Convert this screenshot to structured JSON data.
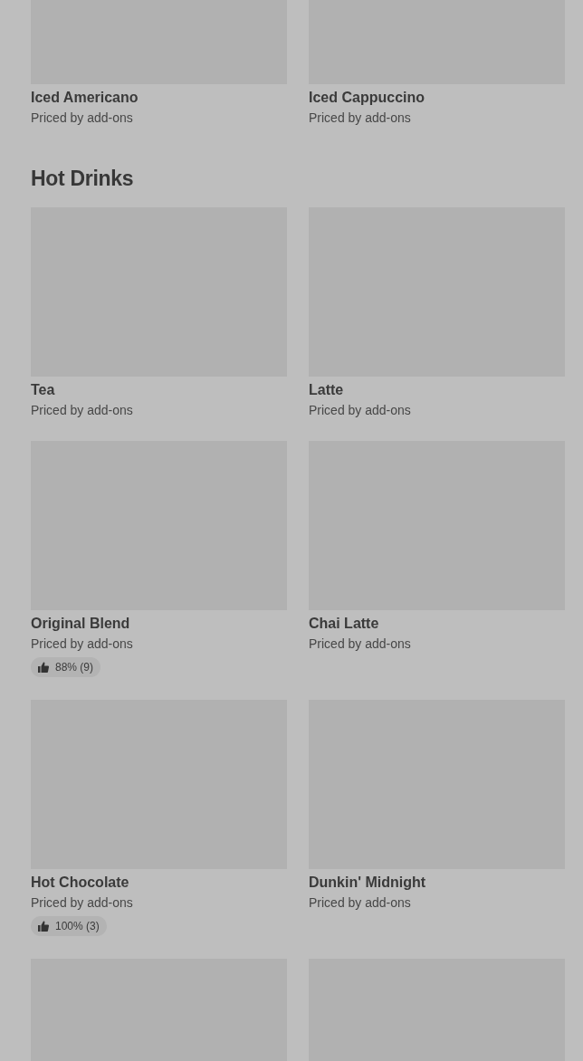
{
  "sections": [
    {
      "items": [
        {
          "kind": "product",
          "title": "Iced Americano",
          "subtitle": "Priced by add-ons"
        },
        {
          "kind": "product",
          "title": "Iced Cappuccino",
          "subtitle": "Priced by add-ons"
        }
      ]
    },
    {
      "title": "Hot Drinks",
      "items": [
        {
          "kind": "product",
          "title": "Tea",
          "subtitle": "Priced by add-ons"
        },
        {
          "kind": "product",
          "title": "Latte",
          "subtitle": "Priced by add-ons"
        },
        {
          "kind": "product",
          "title": "Original Blend",
          "subtitle": "Priced by add-ons",
          "rating": "88% (9)"
        },
        {
          "kind": "product",
          "title": "Chai Latte",
          "subtitle": "Priced by add-ons"
        },
        {
          "kind": "product",
          "title": "Hot Chocolate",
          "subtitle": "Priced by add-ons",
          "rating": "100% (3)"
        },
        {
          "kind": "product",
          "title": "Dunkin' Midnight",
          "subtitle": "Priced by add-ons"
        },
        {
          "kind": "product"
        },
        {
          "kind": "product"
        }
      ]
    }
  ]
}
